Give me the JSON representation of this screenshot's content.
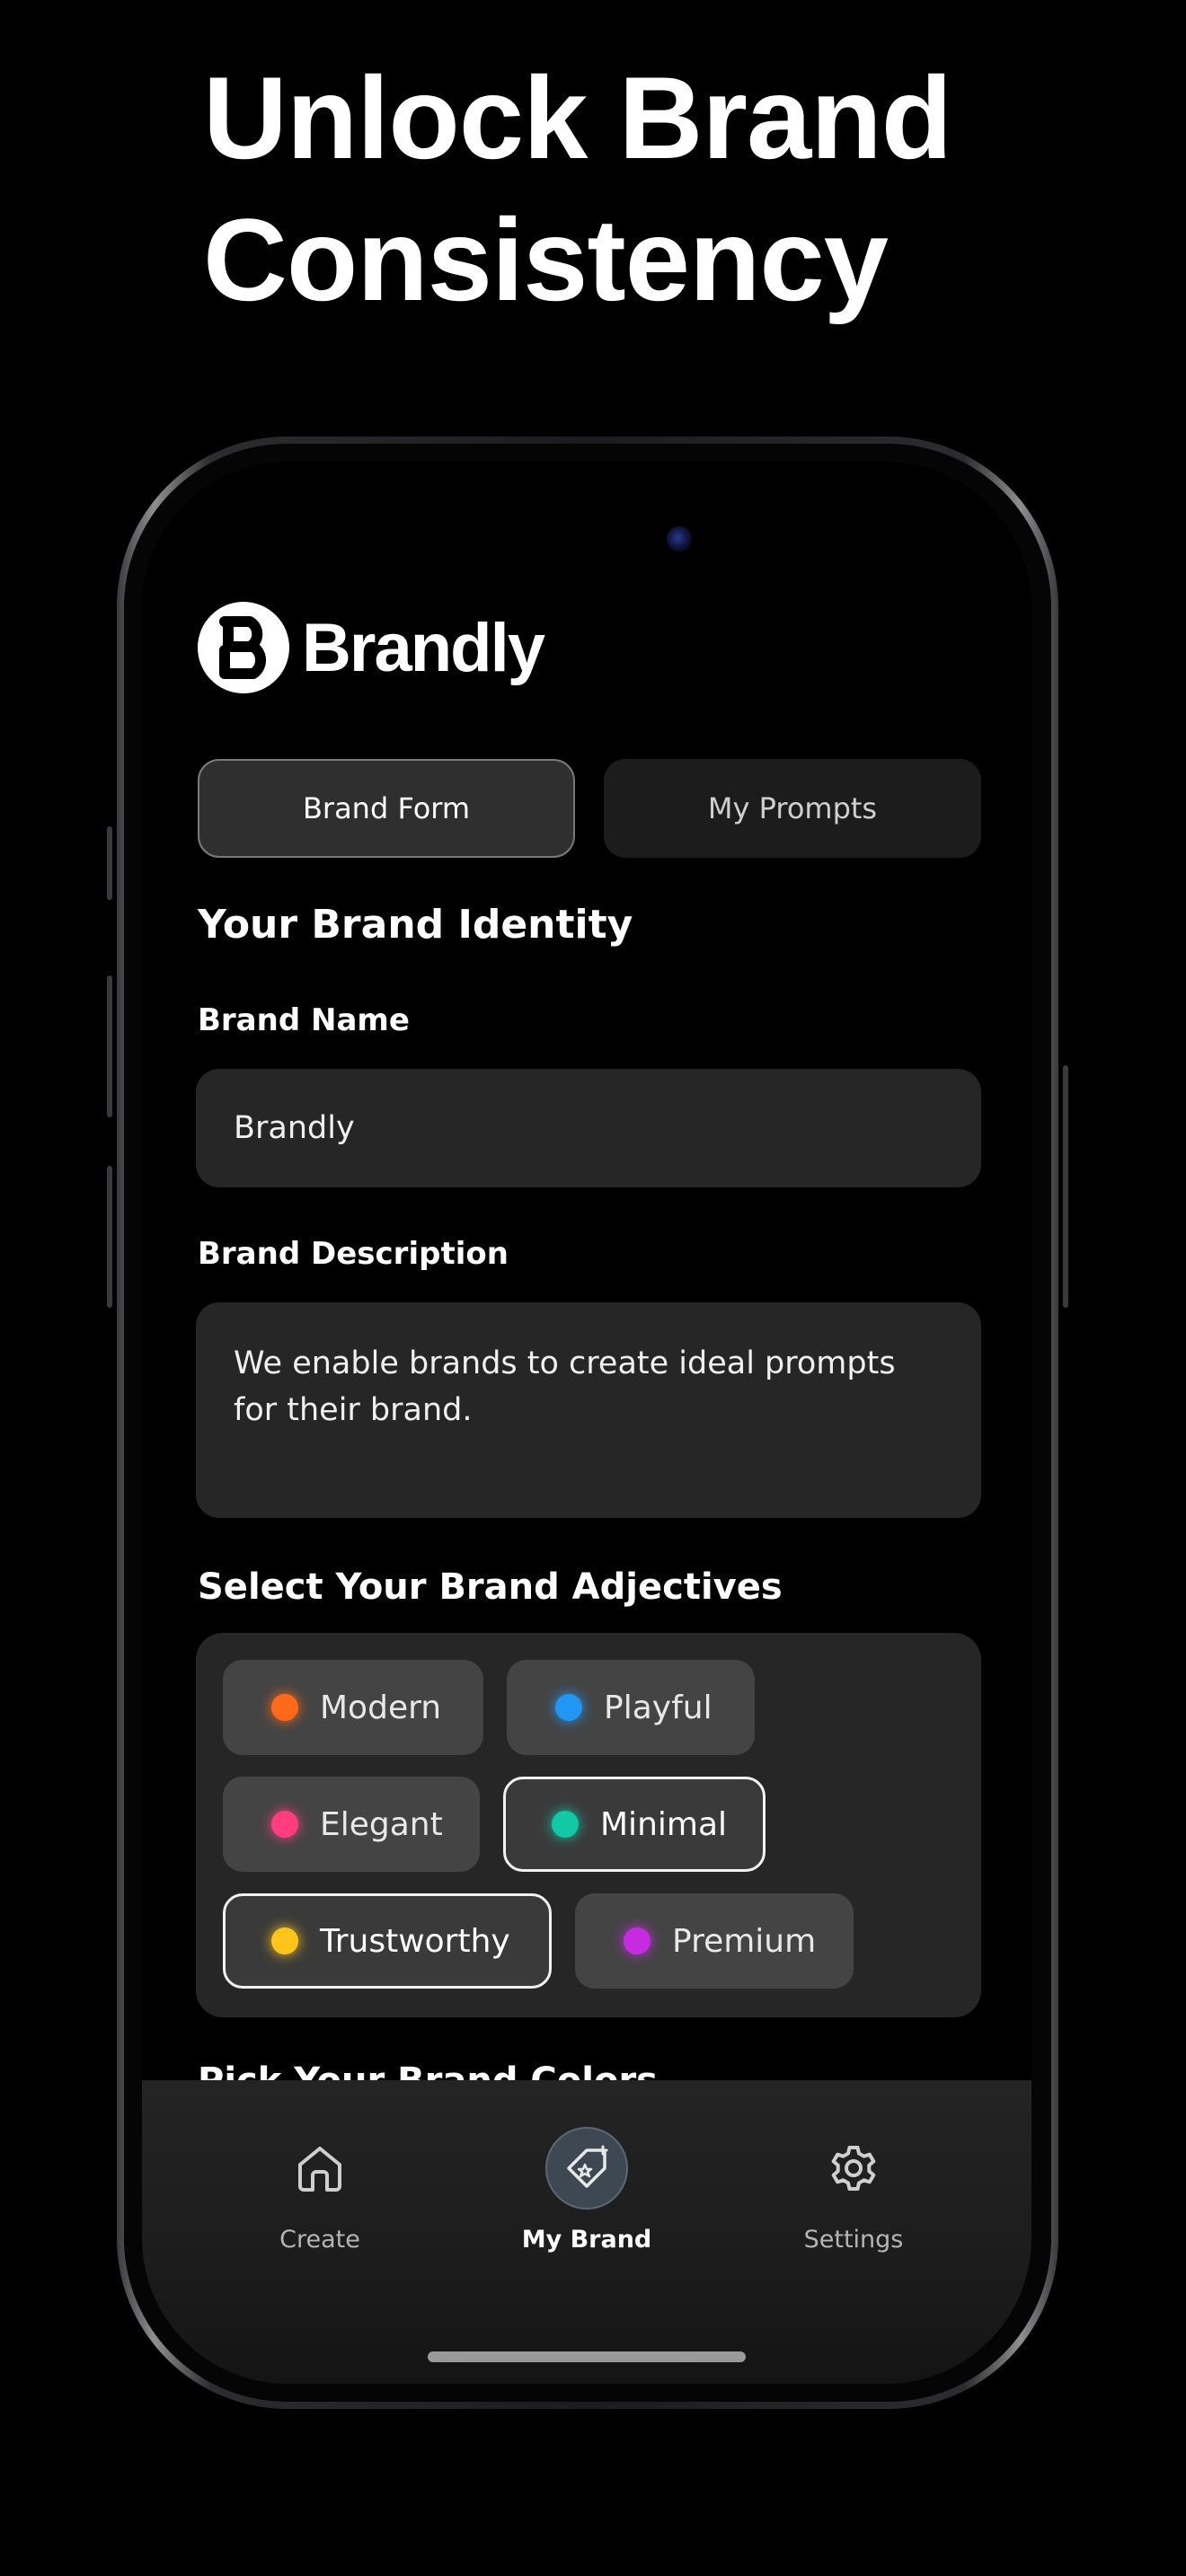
{
  "headline": {
    "line1": "Unlock Brand",
    "line2": "Consistency"
  },
  "app": {
    "logo_text": "Brandly"
  },
  "tabs": [
    {
      "label": "Brand Form",
      "active": true
    },
    {
      "label": "My Prompts",
      "active": false
    }
  ],
  "form": {
    "section_title": "Your Brand Identity",
    "brand_name_label": "Brand Name",
    "brand_name_value": "Brandly",
    "brand_description_label": "Brand Description",
    "brand_description_value": "We enable brands to create ideal prompts for their brand.",
    "adjectives_title": "Select Your Brand Adjectives",
    "adjectives": [
      {
        "label": "Modern",
        "color": "#ff6a1a",
        "selected": false
      },
      {
        "label": "Playful",
        "color": "#2196f3",
        "selected": false
      },
      {
        "label": "Elegant",
        "color": "#ff3d7f",
        "selected": false
      },
      {
        "label": "Minimal",
        "color": "#12c9a6",
        "selected": true
      },
      {
        "label": "Trustworthy",
        "color": "#ffc51a",
        "selected": true
      },
      {
        "label": "Premium",
        "color": "#c62be0",
        "selected": false
      }
    ],
    "next_section_peek": "Pick Your Brand Colors"
  },
  "tabbar": {
    "items": [
      {
        "label": "Create",
        "icon": "home-icon",
        "active": false
      },
      {
        "label": "My Brand",
        "icon": "tag-sparkle-icon",
        "active": true
      },
      {
        "label": "Settings",
        "icon": "gear-icon",
        "active": false
      }
    ]
  }
}
